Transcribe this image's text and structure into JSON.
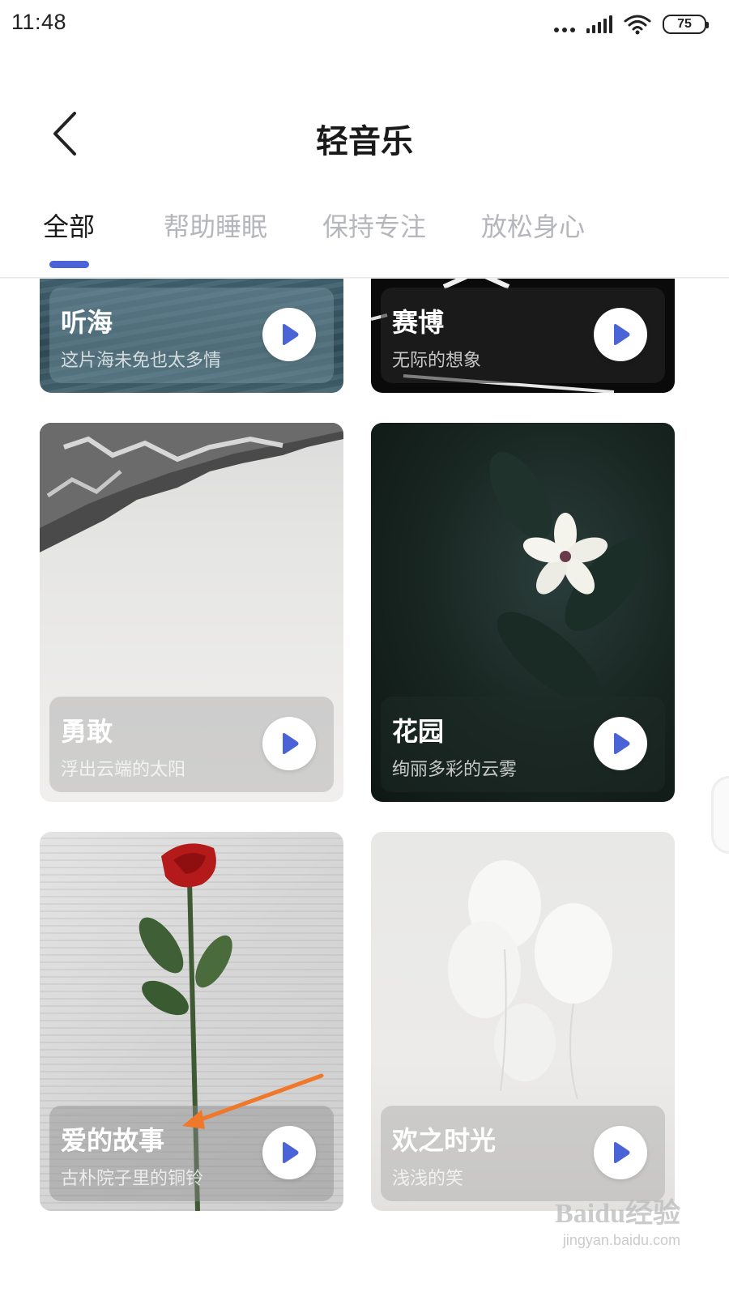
{
  "status_bar": {
    "time": "11:48",
    "battery": "75",
    "icons": [
      "more-dots-icon",
      "signal-icon",
      "wifi-icon",
      "battery-icon"
    ]
  },
  "header": {
    "title": "轻音乐",
    "back_icon": "chevron-left-icon"
  },
  "tabs": [
    {
      "label": "全部",
      "active": true
    },
    {
      "label": "帮助睡眠",
      "active": false
    },
    {
      "label": "保持专注",
      "active": false
    },
    {
      "label": "放松身心",
      "active": false
    }
  ],
  "accent_color": "#4a63d6",
  "cards": [
    {
      "title": "听海",
      "subtitle": "这片海未免也太多情",
      "play_icon": "play-icon"
    },
    {
      "title": "赛博",
      "subtitle": "无际的想象",
      "play_icon": "play-icon"
    },
    {
      "title": "勇敢",
      "subtitle": "浮出云端的太阳",
      "play_icon": "play-icon"
    },
    {
      "title": "花园",
      "subtitle": "绚丽多彩的云雾",
      "play_icon": "play-icon"
    },
    {
      "title": "爱的故事",
      "subtitle": "古朴院子里的铜铃",
      "play_icon": "play-icon"
    },
    {
      "title": "欢之时光",
      "subtitle": "浅浅的笑",
      "play_icon": "play-icon"
    }
  ],
  "watermark": {
    "logo": "Baidu经验",
    "url": "jingyan.baidu.com"
  }
}
